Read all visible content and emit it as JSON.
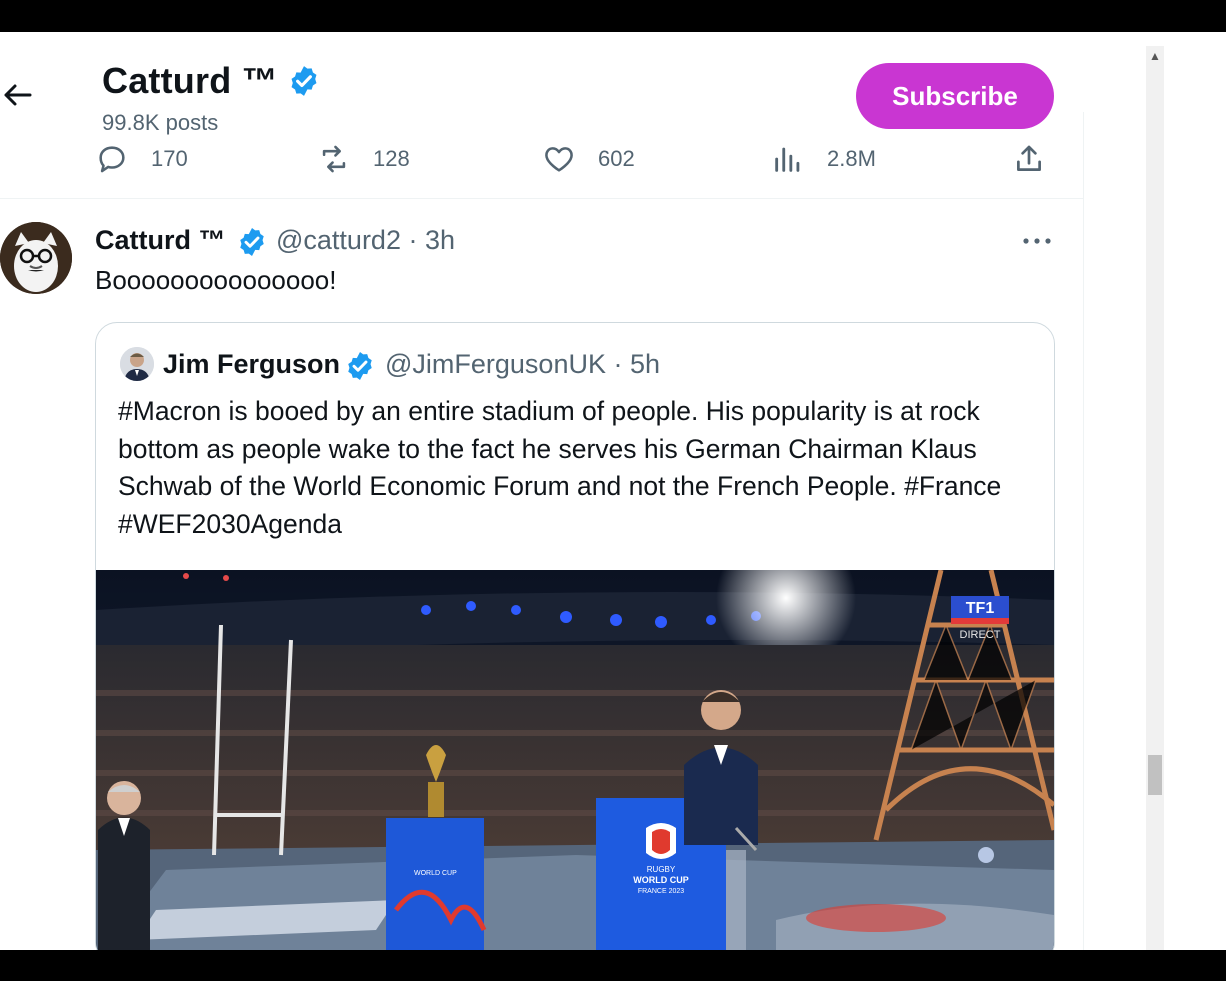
{
  "header": {
    "name": "Catturd ™",
    "posts": "99.8K posts",
    "subscribe_label": "Subscribe"
  },
  "actions": {
    "replies": "170",
    "reposts": "128",
    "likes": "602",
    "views": "2.8M"
  },
  "tweet": {
    "name": "Catturd ™",
    "handle_time": "@catturd2 · 3h",
    "text": "Booooooooooooooo!"
  },
  "quote": {
    "name": "Jim Ferguson",
    "handle_time": "@JimFergusonUK · 5h",
    "text": "#Macron is booed by an entire stadium of people. His popularity is at rock bottom as people wake to the fact he serves his German Chairman Klaus Schwab of the World Economic Forum and not the French People. #France #WEF2030Agenda",
    "media": {
      "channel_logo": "TF1",
      "channel_sub": "DIRECT",
      "podium_text_1": "RUGBY",
      "podium_text_2": "WORLD CUP",
      "podium_text_3": "FRANCE 2023"
    }
  },
  "colors": {
    "subscribe_bg": "#c936d2",
    "verified": "#1d9bf0",
    "secondary_text": "#536471"
  },
  "icons": [
    "back-arrow-icon",
    "verified-icon",
    "reply-icon",
    "repost-icon",
    "like-icon",
    "views-icon",
    "share-icon",
    "more-icon"
  ]
}
